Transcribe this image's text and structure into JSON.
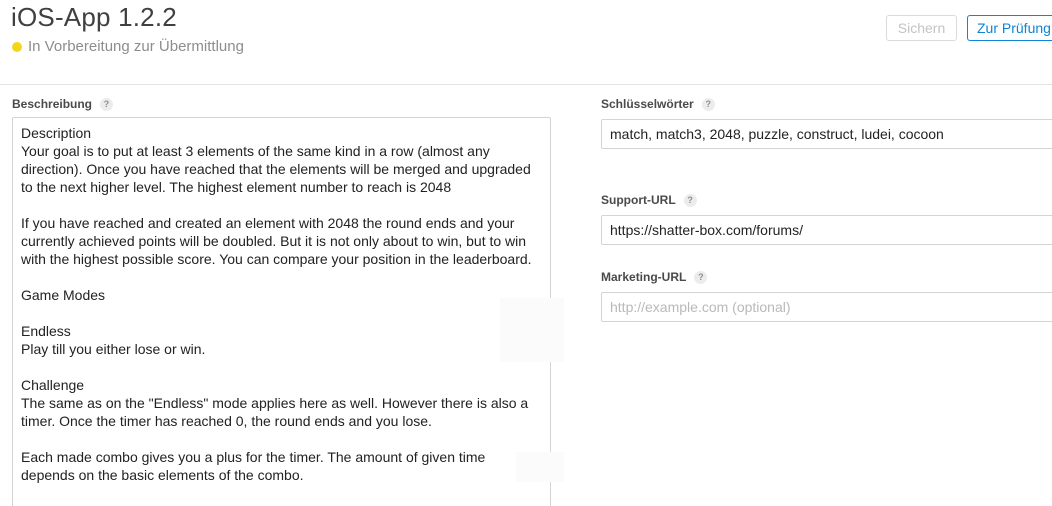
{
  "header": {
    "app_title": "iOS-App 1.2.2",
    "status_text": "In Vorbereitung zur Übermittlung",
    "status_color": "#f3d61c",
    "save_label": "Sichern",
    "review_label": "Zur Prüfung"
  },
  "description": {
    "label": "Beschreibung",
    "help": "?",
    "value": "Description\nYour goal is to put at least 3 elements of the same kind in a row (almost any direction). Once you have reached that the elements will be merged and upgraded to the next higher level. The highest element number to reach is 2048\n\nIf you have reached and created an element with 2048 the round ends and your currently achieved points will be doubled. But it is not only about to win, but to win with the highest possible score. You can compare your position in the leaderboard.\n\nGame Modes\n\nEndless\nPlay till you either lose or win.\n\nChallenge\nThe same as on the \"Endless\" mode applies here as well. However there is also a timer. Once the timer has reached 0, the round ends and you lose.\n\nEach made combo gives you a plus for the timer. The amount of given time depends on the basic elements of the combo."
  },
  "keywords": {
    "label": "Schlüsselwörter",
    "help": "?",
    "value": "match, match3,  2048, puzzle, construct, ludei, cocoon"
  },
  "support_url": {
    "label": "Support-URL",
    "help": "?",
    "value": "https://shatter-box.com/forums/"
  },
  "marketing_url": {
    "label": "Marketing-URL",
    "help": "?",
    "placeholder": "http://example.com (optional)"
  },
  "colors": {
    "accent": "#0f84d8",
    "disabled_text": "#c3c3c3",
    "border": "#d4d4d4"
  }
}
